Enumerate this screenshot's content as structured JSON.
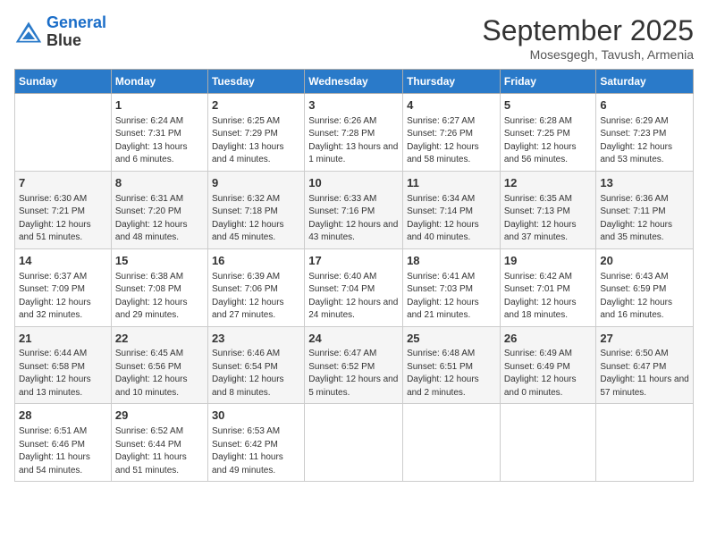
{
  "header": {
    "logo_line1": "General",
    "logo_line2": "Blue",
    "month": "September 2025",
    "location": "Mosesgegh, Tavush, Armenia"
  },
  "days_of_week": [
    "Sunday",
    "Monday",
    "Tuesday",
    "Wednesday",
    "Thursday",
    "Friday",
    "Saturday"
  ],
  "weeks": [
    [
      {
        "day": "",
        "sunrise": "",
        "sunset": "",
        "daylight": ""
      },
      {
        "day": "1",
        "sunrise": "Sunrise: 6:24 AM",
        "sunset": "Sunset: 7:31 PM",
        "daylight": "Daylight: 13 hours and 6 minutes."
      },
      {
        "day": "2",
        "sunrise": "Sunrise: 6:25 AM",
        "sunset": "Sunset: 7:29 PM",
        "daylight": "Daylight: 13 hours and 4 minutes."
      },
      {
        "day": "3",
        "sunrise": "Sunrise: 6:26 AM",
        "sunset": "Sunset: 7:28 PM",
        "daylight": "Daylight: 13 hours and 1 minute."
      },
      {
        "day": "4",
        "sunrise": "Sunrise: 6:27 AM",
        "sunset": "Sunset: 7:26 PM",
        "daylight": "Daylight: 12 hours and 58 minutes."
      },
      {
        "day": "5",
        "sunrise": "Sunrise: 6:28 AM",
        "sunset": "Sunset: 7:25 PM",
        "daylight": "Daylight: 12 hours and 56 minutes."
      },
      {
        "day": "6",
        "sunrise": "Sunrise: 6:29 AM",
        "sunset": "Sunset: 7:23 PM",
        "daylight": "Daylight: 12 hours and 53 minutes."
      }
    ],
    [
      {
        "day": "7",
        "sunrise": "Sunrise: 6:30 AM",
        "sunset": "Sunset: 7:21 PM",
        "daylight": "Daylight: 12 hours and 51 minutes."
      },
      {
        "day": "8",
        "sunrise": "Sunrise: 6:31 AM",
        "sunset": "Sunset: 7:20 PM",
        "daylight": "Daylight: 12 hours and 48 minutes."
      },
      {
        "day": "9",
        "sunrise": "Sunrise: 6:32 AM",
        "sunset": "Sunset: 7:18 PM",
        "daylight": "Daylight: 12 hours and 45 minutes."
      },
      {
        "day": "10",
        "sunrise": "Sunrise: 6:33 AM",
        "sunset": "Sunset: 7:16 PM",
        "daylight": "Daylight: 12 hours and 43 minutes."
      },
      {
        "day": "11",
        "sunrise": "Sunrise: 6:34 AM",
        "sunset": "Sunset: 7:14 PM",
        "daylight": "Daylight: 12 hours and 40 minutes."
      },
      {
        "day": "12",
        "sunrise": "Sunrise: 6:35 AM",
        "sunset": "Sunset: 7:13 PM",
        "daylight": "Daylight: 12 hours and 37 minutes."
      },
      {
        "day": "13",
        "sunrise": "Sunrise: 6:36 AM",
        "sunset": "Sunset: 7:11 PM",
        "daylight": "Daylight: 12 hours and 35 minutes."
      }
    ],
    [
      {
        "day": "14",
        "sunrise": "Sunrise: 6:37 AM",
        "sunset": "Sunset: 7:09 PM",
        "daylight": "Daylight: 12 hours and 32 minutes."
      },
      {
        "day": "15",
        "sunrise": "Sunrise: 6:38 AM",
        "sunset": "Sunset: 7:08 PM",
        "daylight": "Daylight: 12 hours and 29 minutes."
      },
      {
        "day": "16",
        "sunrise": "Sunrise: 6:39 AM",
        "sunset": "Sunset: 7:06 PM",
        "daylight": "Daylight: 12 hours and 27 minutes."
      },
      {
        "day": "17",
        "sunrise": "Sunrise: 6:40 AM",
        "sunset": "Sunset: 7:04 PM",
        "daylight": "Daylight: 12 hours and 24 minutes."
      },
      {
        "day": "18",
        "sunrise": "Sunrise: 6:41 AM",
        "sunset": "Sunset: 7:03 PM",
        "daylight": "Daylight: 12 hours and 21 minutes."
      },
      {
        "day": "19",
        "sunrise": "Sunrise: 6:42 AM",
        "sunset": "Sunset: 7:01 PM",
        "daylight": "Daylight: 12 hours and 18 minutes."
      },
      {
        "day": "20",
        "sunrise": "Sunrise: 6:43 AM",
        "sunset": "Sunset: 6:59 PM",
        "daylight": "Daylight: 12 hours and 16 minutes."
      }
    ],
    [
      {
        "day": "21",
        "sunrise": "Sunrise: 6:44 AM",
        "sunset": "Sunset: 6:58 PM",
        "daylight": "Daylight: 12 hours and 13 minutes."
      },
      {
        "day": "22",
        "sunrise": "Sunrise: 6:45 AM",
        "sunset": "Sunset: 6:56 PM",
        "daylight": "Daylight: 12 hours and 10 minutes."
      },
      {
        "day": "23",
        "sunrise": "Sunrise: 6:46 AM",
        "sunset": "Sunset: 6:54 PM",
        "daylight": "Daylight: 12 hours and 8 minutes."
      },
      {
        "day": "24",
        "sunrise": "Sunrise: 6:47 AM",
        "sunset": "Sunset: 6:52 PM",
        "daylight": "Daylight: 12 hours and 5 minutes."
      },
      {
        "day": "25",
        "sunrise": "Sunrise: 6:48 AM",
        "sunset": "Sunset: 6:51 PM",
        "daylight": "Daylight: 12 hours and 2 minutes."
      },
      {
        "day": "26",
        "sunrise": "Sunrise: 6:49 AM",
        "sunset": "Sunset: 6:49 PM",
        "daylight": "Daylight: 12 hours and 0 minutes."
      },
      {
        "day": "27",
        "sunrise": "Sunrise: 6:50 AM",
        "sunset": "Sunset: 6:47 PM",
        "daylight": "Daylight: 11 hours and 57 minutes."
      }
    ],
    [
      {
        "day": "28",
        "sunrise": "Sunrise: 6:51 AM",
        "sunset": "Sunset: 6:46 PM",
        "daylight": "Daylight: 11 hours and 54 minutes."
      },
      {
        "day": "29",
        "sunrise": "Sunrise: 6:52 AM",
        "sunset": "Sunset: 6:44 PM",
        "daylight": "Daylight: 11 hours and 51 minutes."
      },
      {
        "day": "30",
        "sunrise": "Sunrise: 6:53 AM",
        "sunset": "Sunset: 6:42 PM",
        "daylight": "Daylight: 11 hours and 49 minutes."
      },
      {
        "day": "",
        "sunrise": "",
        "sunset": "",
        "daylight": ""
      },
      {
        "day": "",
        "sunrise": "",
        "sunset": "",
        "daylight": ""
      },
      {
        "day": "",
        "sunrise": "",
        "sunset": "",
        "daylight": ""
      },
      {
        "day": "",
        "sunrise": "",
        "sunset": "",
        "daylight": ""
      }
    ]
  ]
}
